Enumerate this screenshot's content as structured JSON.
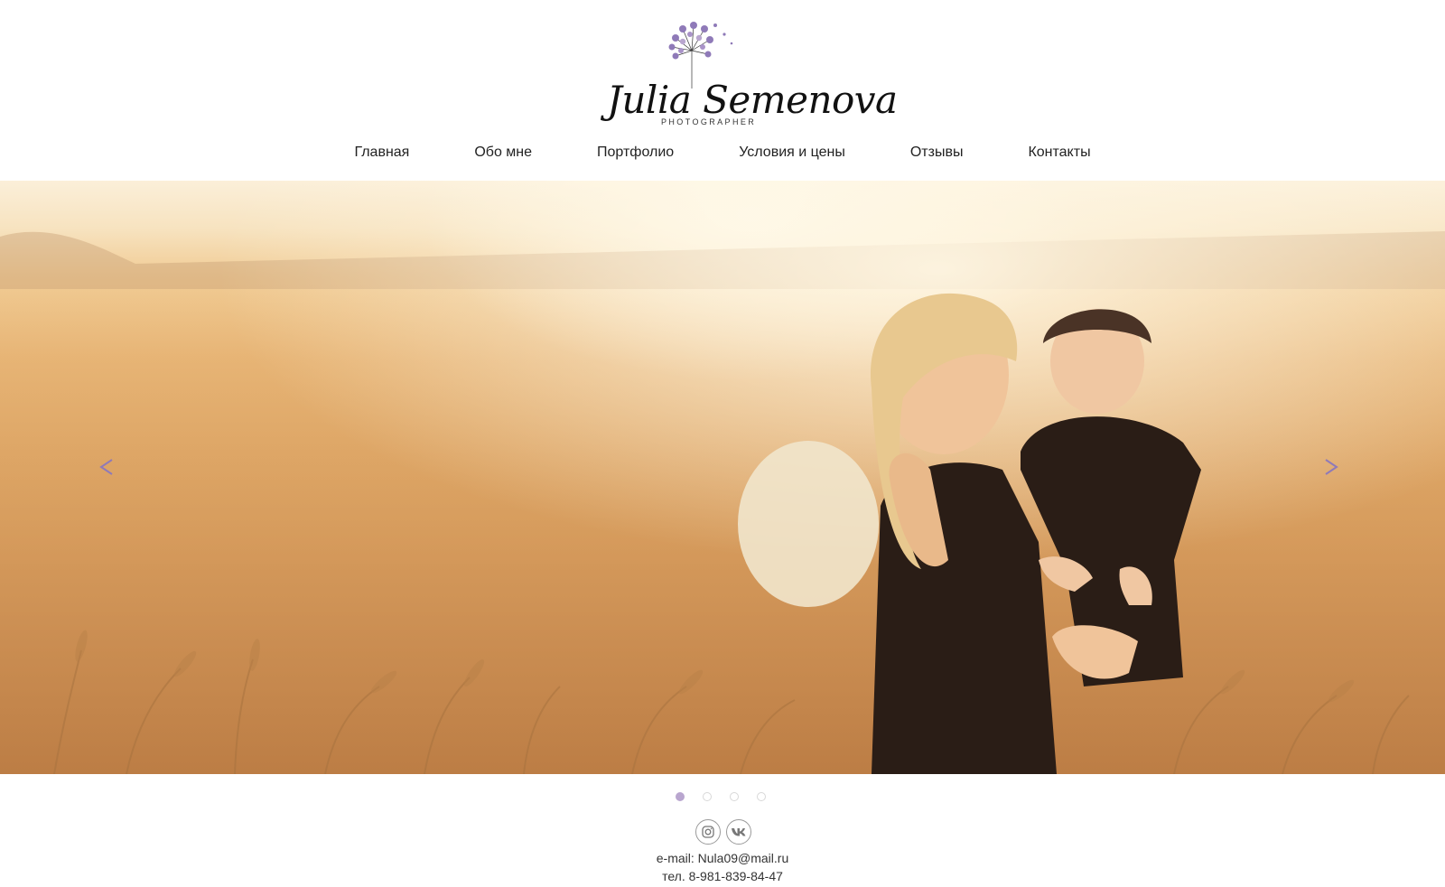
{
  "logo": {
    "name": "Julia Semenova",
    "subtitle": "PHOTOGRAPHER",
    "icon": "dandelion-icon",
    "accent_color": "#8f7ab8"
  },
  "nav": {
    "items": [
      {
        "label": "Главная"
      },
      {
        "label": "Обо мне"
      },
      {
        "label": "Портфолио"
      },
      {
        "label": "Условия и цены"
      },
      {
        "label": "Отзывы"
      },
      {
        "label": "Контакты"
      }
    ]
  },
  "slider": {
    "prev_icon": "chevron-left-icon",
    "next_icon": "chevron-right-icon",
    "arrow_color": "#8f7ab8",
    "slide_count": 4,
    "active_slide": 1
  },
  "footer": {
    "social": [
      {
        "icon": "instagram-icon"
      },
      {
        "icon": "vk-icon"
      }
    ],
    "email_label": "e-mail:",
    "email": "Nula09@mail.ru",
    "phone_label": "тел.",
    "phone": "8-981-839-84-47"
  }
}
